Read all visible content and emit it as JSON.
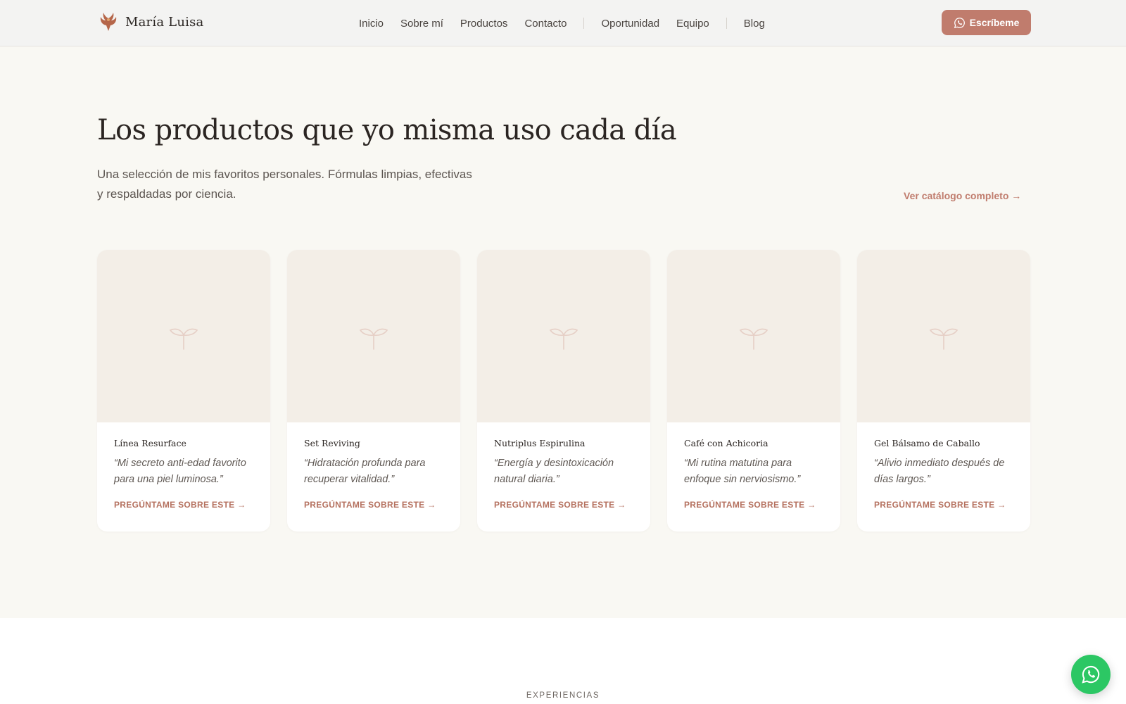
{
  "brand": {
    "name": "María Luisa",
    "logo_icon": "phoenix-icon"
  },
  "nav": {
    "group1": [
      "Inicio",
      "Sobre mí",
      "Productos",
      "Contacto"
    ],
    "group2": [
      "Oportunidad",
      "Equipo"
    ],
    "group3": [
      "Blog"
    ]
  },
  "cta": {
    "label": "Escríbeme",
    "icon": "whatsapp-icon",
    "color": "#c07c6d"
  },
  "products": {
    "title": "Los productos que yo misma uso cada día",
    "subtitle": "Una selección de mis favoritos personales. Fórmulas limpias, efectivas y respaldadas por ciencia.",
    "catalog_link": "Ver catálogo completo →",
    "cards": [
      {
        "name": "Línea Resurface",
        "quote": "“Mi secreto anti-edad favorito para una piel luminosa.”",
        "link": "PREGÚNTAME SOBRE ESTE →"
      },
      {
        "name": "Set Reviving",
        "quote": "“Hidratación profunda para recuperar vitalidad.”",
        "link": "PREGÚNTAME SOBRE ESTE →"
      },
      {
        "name": "Nutriplus Espirulina",
        "quote": "“Energía y desintoxicación natural diaria.”",
        "link": "PREGÚNTAME SOBRE ESTE →"
      },
      {
        "name": "Café con Achicoria",
        "quote": "“Mi rutina matutina para enfoque sin nerviosismo.”",
        "link": "PREGÚNTAME SOBRE ESTE →"
      },
      {
        "name": "Gel Bálsamo de Caballo",
        "quote": "“Alivio inmediato después de días largos.”",
        "link": "PREGÚNTAME SOBRE ESTE →"
      }
    ],
    "placeholder_icon": "sprout-icon"
  },
  "experiences": {
    "eyebrow": "EXPERIENCIAS"
  },
  "floating_button": {
    "icon": "whatsapp-icon",
    "color": "#2cc764"
  }
}
